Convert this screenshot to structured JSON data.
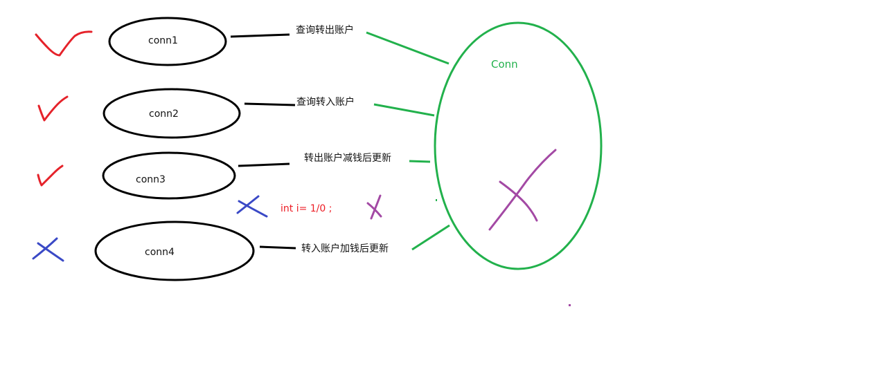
{
  "colors": {
    "black": "#000000",
    "red": "#e5222a",
    "blue": "#3a49c6",
    "green": "#22b14c",
    "purple": "#a349a4",
    "code_red": "#ed1c24"
  },
  "connections": [
    {
      "name": "conn1",
      "step": "查询转出账户",
      "status": "check"
    },
    {
      "name": "conn2",
      "step": "查询转入账户",
      "status": "check"
    },
    {
      "name": "conn3",
      "step": "转出账户减钱后更新",
      "status": "check"
    },
    {
      "name": "conn4",
      "step": "转入账户加钱后更新",
      "status": "cross"
    }
  ],
  "shared_connection": {
    "label": "Conn"
  },
  "error_code": {
    "text": "int i= 1/0 ;"
  }
}
